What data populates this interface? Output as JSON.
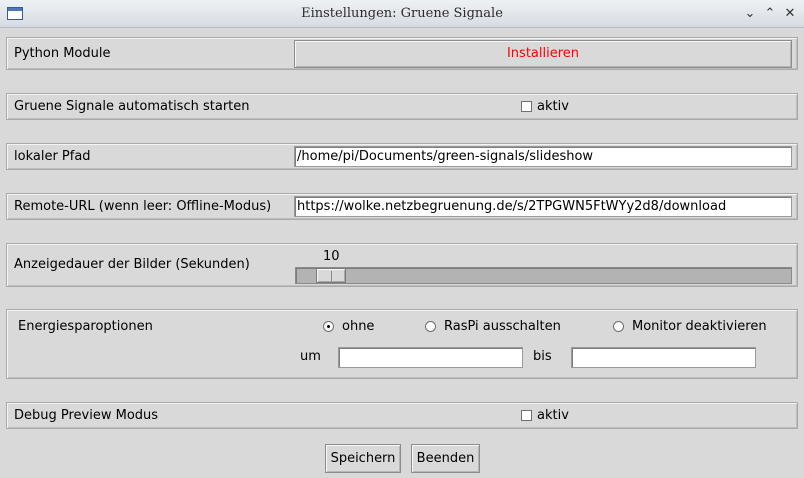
{
  "window": {
    "title": "Einstellungen: Gruene Signale",
    "icons": {
      "app": "window-icon",
      "minimize": "minimize-icon",
      "maximize": "maximize-icon",
      "close": "close-icon"
    }
  },
  "python_module": {
    "label": "Python Module",
    "button_label": "Installieren",
    "button_color": "#ff0000"
  },
  "autostart": {
    "label": "Gruene Signale automatisch starten",
    "checkbox_label": "aktiv",
    "checked": false
  },
  "local_path": {
    "label": "lokaler Pfad",
    "value": "/home/pi/Documents/green-signals/slideshow"
  },
  "remote_url": {
    "label": "Remote-URL (wenn leer: Offline-Modus)",
    "value": "https://wolke.netzbegruenung.de/s/2TPGWN5FtWYy2d8/download"
  },
  "display_duration": {
    "label": "Anzeigedauer der Bilder (Sekunden)",
    "value_text": "10",
    "value": 10
  },
  "energy": {
    "label": "Energiesparoptionen",
    "options": [
      {
        "label": "ohne",
        "selected": true
      },
      {
        "label": "RasPi ausschalten",
        "selected": false
      },
      {
        "label": "Monitor deaktivieren",
        "selected": false
      }
    ],
    "from_label": "um",
    "from_value": "",
    "to_label": "bis",
    "to_value": ""
  },
  "debug": {
    "label": "Debug Preview Modus",
    "checkbox_label": "aktiv",
    "checked": false
  },
  "footer": {
    "save_label": "Speichern",
    "quit_label": "Beenden"
  }
}
